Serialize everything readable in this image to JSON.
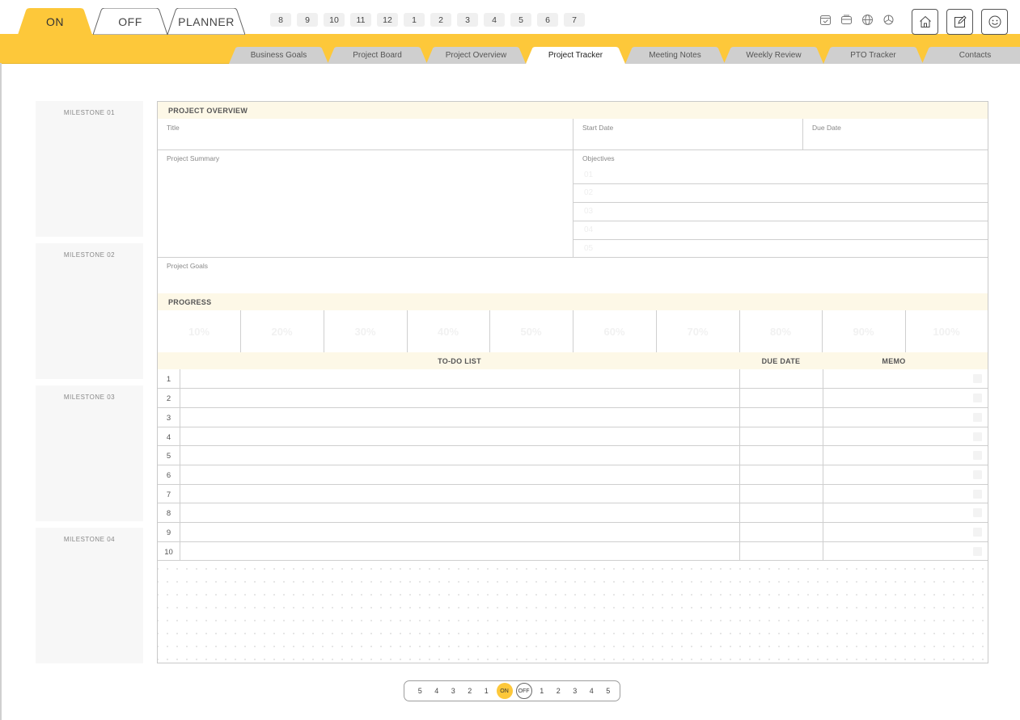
{
  "main_tabs": {
    "on": "ON",
    "off": "OFF",
    "planner": "PLANNER"
  },
  "number_tabs": [
    "8",
    "9",
    "10",
    "11",
    "12",
    "1",
    "2",
    "3",
    "4",
    "5",
    "6",
    "7"
  ],
  "toolbar_icons": [
    "calendar-check-icon",
    "wallet-icon",
    "globe-icon",
    "openai-icon"
  ],
  "header_buttons": [
    "home-icon",
    "edit-icon",
    "smiley-icon"
  ],
  "sub_tabs": [
    "Business Goals",
    "Project Board",
    "Project Overview",
    "Project Tracker",
    "Meeting Notes",
    "Weekly Review",
    "PTO Tracker",
    "Contacts"
  ],
  "active_sub_tab": "Project Tracker",
  "milestones": [
    "MILESTONE 01",
    "MILESTONE 02",
    "MILESTONE 03",
    "MILESTONE 04"
  ],
  "overview": {
    "heading": "PROJECT OVERVIEW",
    "title_label": "Title",
    "start_date_label": "Start Date",
    "due_date_label": "Due Date",
    "summary_label": "Project Summary",
    "objectives_label": "Objectives",
    "objectives": [
      "01",
      "02",
      "03",
      "04",
      "05"
    ],
    "goals_label": "Project Goals"
  },
  "progress": {
    "heading": "PROGRESS",
    "steps": [
      "10%",
      "20%",
      "30%",
      "40%",
      "50%",
      "60%",
      "70%",
      "80%",
      "90%",
      "100%"
    ]
  },
  "todo": {
    "col_list": "TO-DO LIST",
    "col_due": "DUE DATE",
    "col_memo": "MEMO",
    "rows": [
      "1",
      "2",
      "3",
      "4",
      "5",
      "6",
      "7",
      "8",
      "9",
      "10"
    ]
  },
  "pager": {
    "left": [
      "5",
      "4",
      "3",
      "2",
      "1"
    ],
    "on": "ON",
    "off": "OFF",
    "right": [
      "1",
      "2",
      "3",
      "4",
      "5"
    ]
  },
  "colors": {
    "accent": "#fdc83a",
    "section_bg": "#fdf8e7",
    "tab_gray": "#cfcfcf"
  }
}
